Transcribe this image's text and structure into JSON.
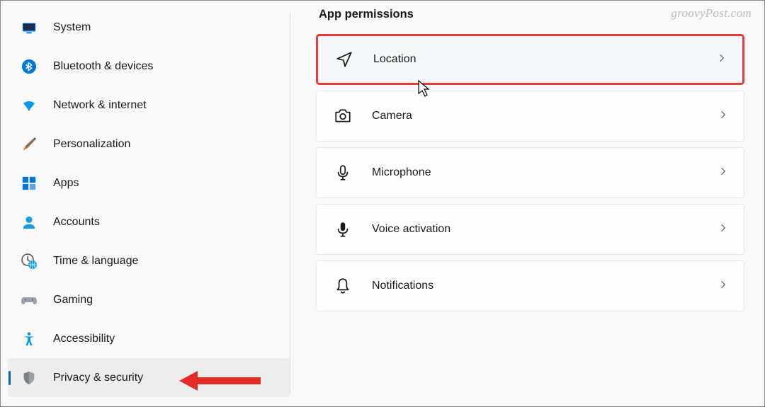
{
  "watermark": "groovyPost.com",
  "main": {
    "heading": "App permissions",
    "items": [
      {
        "key": "location",
        "label": "Location",
        "highlighted": true
      },
      {
        "key": "camera",
        "label": "Camera",
        "highlighted": false
      },
      {
        "key": "microphone",
        "label": "Microphone",
        "highlighted": false
      },
      {
        "key": "voice-activation",
        "label": "Voice activation",
        "highlighted": false
      },
      {
        "key": "notifications",
        "label": "Notifications",
        "highlighted": false
      }
    ]
  },
  "sidebar": {
    "items": [
      {
        "key": "system",
        "label": "System",
        "active": false
      },
      {
        "key": "bluetooth",
        "label": "Bluetooth & devices",
        "active": false
      },
      {
        "key": "network",
        "label": "Network & internet",
        "active": false
      },
      {
        "key": "personalization",
        "label": "Personalization",
        "active": false
      },
      {
        "key": "apps",
        "label": "Apps",
        "active": false
      },
      {
        "key": "accounts",
        "label": "Accounts",
        "active": false
      },
      {
        "key": "time-language",
        "label": "Time & language",
        "active": false
      },
      {
        "key": "gaming",
        "label": "Gaming",
        "active": false
      },
      {
        "key": "accessibility",
        "label": "Accessibility",
        "active": false
      },
      {
        "key": "privacy-security",
        "label": "Privacy & security",
        "active": true
      }
    ]
  },
  "annotations": {
    "red_arrow_target": "privacy-security",
    "cursor_on": "location"
  }
}
